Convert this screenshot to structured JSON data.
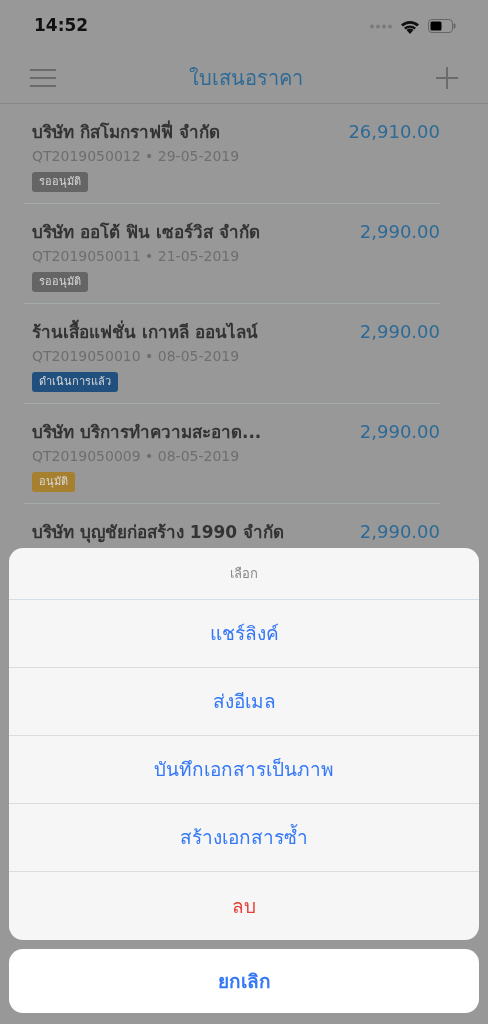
{
  "status_bar": {
    "time": "14:52"
  },
  "nav": {
    "title": "ใบเสนอราคา"
  },
  "quotes": [
    {
      "company": "บริษัท กิสโมกราฟฟี่ จำกัด",
      "amount": "26,910.00",
      "meta": "QT2019050012 • 29-05-2019",
      "status": "รออนุมัติ",
      "color": "#656565"
    },
    {
      "company": "บริษัท ออโต้ ฟิน เซอร์วิส จำกัด",
      "amount": "2,990.00",
      "meta": "QT2019050011 • 21-05-2019",
      "status": "รออนุมัติ",
      "color": "#656565"
    },
    {
      "company": "ร้านเสื้อแฟชั่น เกาหลี ออนไลน์",
      "amount": "2,990.00",
      "meta": "QT2019050010 • 08-05-2019",
      "status": "ดำเนินการแล้ว",
      "color": "#21507f"
    },
    {
      "company": "บริษัท บริการทำความสะอาด...",
      "amount": "2,990.00",
      "meta": "QT2019050009 • 08-05-2019",
      "status": "อนุมัติ",
      "color": "#a7802f"
    },
    {
      "company": "บริษัท บุญชัยก่อสร้าง 1990 จำกัด",
      "amount": "2,990.00"
    }
  ],
  "action_sheet": {
    "title": "เลือก",
    "actions": [
      {
        "label": "แชร์ลิงค์",
        "kind": "default"
      },
      {
        "label": "ส่งอีเมล",
        "kind": "default"
      },
      {
        "label": "บันทึกเอกสารเป็นภาพ",
        "kind": "default"
      },
      {
        "label": "สร้างเอกสารซ้ำ",
        "kind": "default"
      },
      {
        "label": "ลบ",
        "kind": "destructive"
      }
    ],
    "cancel": "ยกเลิก"
  }
}
